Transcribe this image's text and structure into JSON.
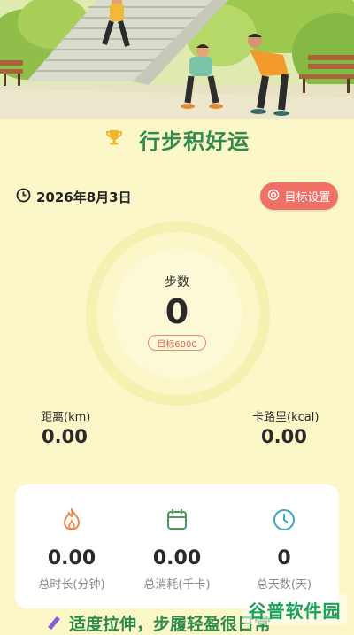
{
  "header": {
    "title": "行步积好运"
  },
  "date": {
    "text": "2026年8月3日"
  },
  "goal_button": {
    "label": "目标设置"
  },
  "steps": {
    "label": "步数",
    "value": "0",
    "goal": "目标6000"
  },
  "metrics": {
    "distance": {
      "label": "距离(km)",
      "value": "0.00"
    },
    "calories": {
      "label": "卡路里(kcal)",
      "value": "0.00"
    }
  },
  "summary": [
    {
      "icon": "flame-icon",
      "value": "0.00",
      "label": "总时长(分钟)"
    },
    {
      "icon": "calendar-icon",
      "value": "0.00",
      "label": "总消耗(千卡)"
    },
    {
      "icon": "clock-icon",
      "value": "0",
      "label": "总天数(天)"
    }
  ],
  "banner": {
    "text": "适度拉伸，步履轻盈很日常"
  },
  "watermark": {
    "text": "谷普软件园"
  },
  "colors": {
    "background": "#fbf7c8",
    "accent_green": "#2f8a4b",
    "goal_red": "#ef7066",
    "flame": "#ea8a4a",
    "calendar": "#4c9a5a",
    "clock": "#3aa6c8"
  }
}
